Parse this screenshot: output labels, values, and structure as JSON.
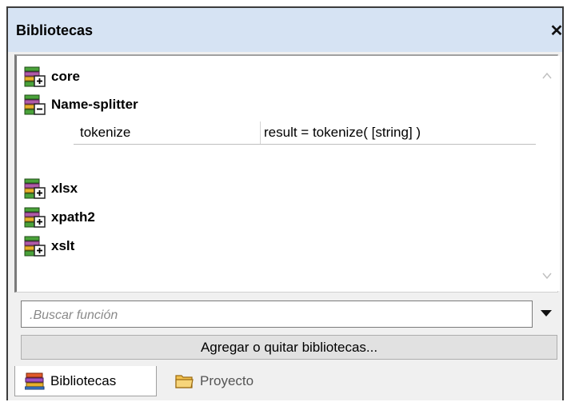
{
  "panel": {
    "title": "Bibliotecas",
    "close_glyph": "✕"
  },
  "tree": {
    "libraries": [
      {
        "label": "core",
        "expanded": false,
        "icon": "library-expand-icon"
      },
      {
        "label": "Name-splitter",
        "expanded": true,
        "icon": "library-collapse-icon"
      },
      {
        "label": "xlsx",
        "expanded": false,
        "icon": "library-expand-icon"
      },
      {
        "label": "xpath2",
        "expanded": false,
        "icon": "library-expand-icon"
      },
      {
        "label": "xslt",
        "expanded": false,
        "icon": "library-expand-icon"
      }
    ],
    "functions": [
      {
        "name": "tokenize",
        "signature": "result = tokenize( [string] )"
      }
    ]
  },
  "search": {
    "placeholder": ".Buscar función"
  },
  "buttons": {
    "add_remove": "Agregar o quitar bibliotecas..."
  },
  "tabs": [
    {
      "label": "Bibliotecas",
      "active": true,
      "icon": "books-icon"
    },
    {
      "label": "Proyecto",
      "active": false,
      "icon": "folder-icon"
    }
  ],
  "colors": {
    "titlebar": "#d6e3f3",
    "panel_bg": "#f0f0f0",
    "button_bg": "#e1e1e1"
  }
}
